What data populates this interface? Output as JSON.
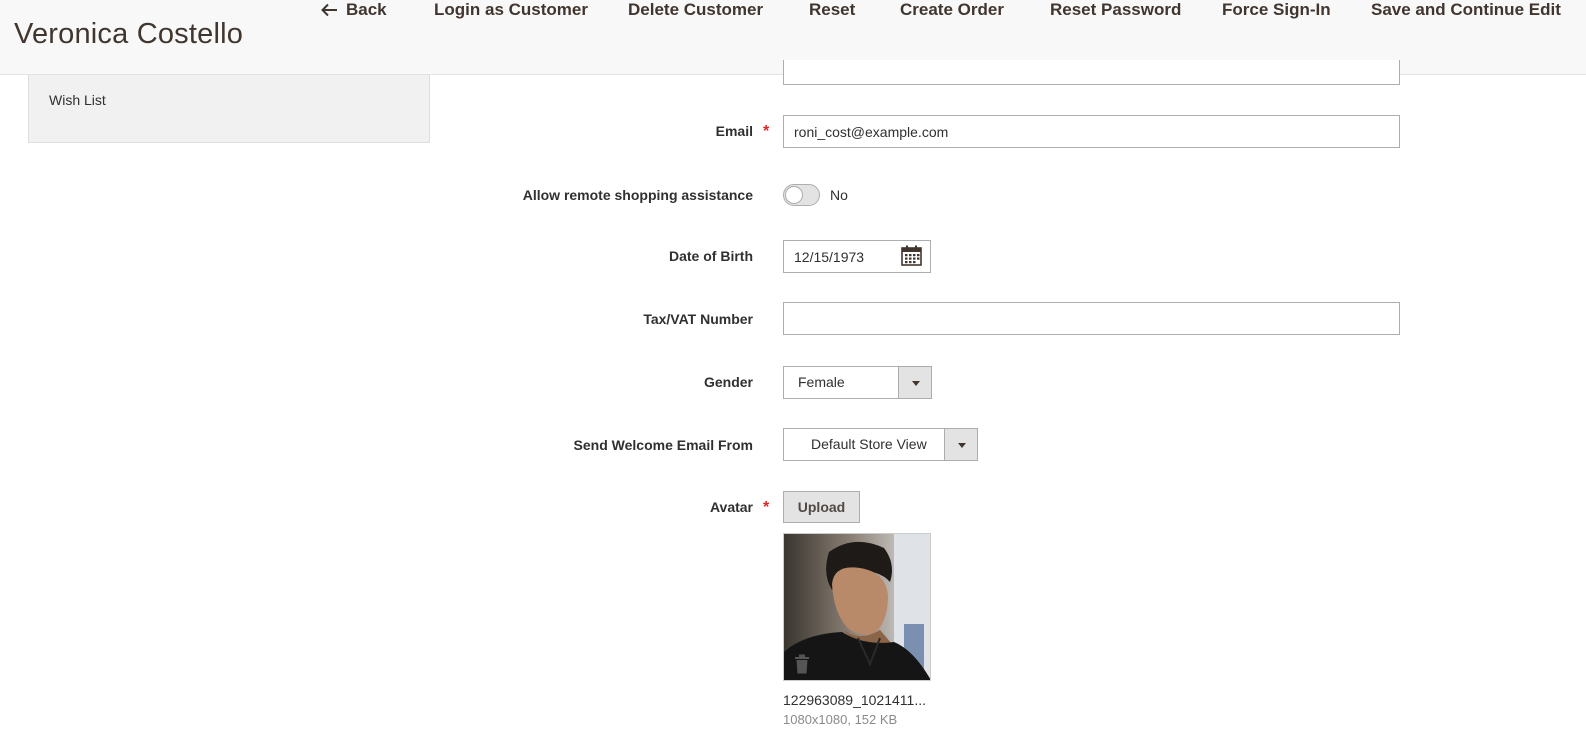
{
  "header": {
    "title": "Veronica Costello",
    "actions": {
      "back": "Back",
      "login_as_customer": "Login as Customer",
      "delete_customer": "Delete Customer",
      "reset": "Reset",
      "create_order": "Create Order",
      "reset_password": "Reset Password",
      "force_sign_in": "Force Sign-In",
      "save_continue": "Save and Continue Edit"
    }
  },
  "sidebar": {
    "items": [
      {
        "label": "Wish List"
      }
    ]
  },
  "form": {
    "email": {
      "label": "Email",
      "value": "roni_cost@example.com",
      "required": true
    },
    "remote_assistance": {
      "label": "Allow remote shopping assistance",
      "state_text": "No",
      "enabled": false
    },
    "dob": {
      "label": "Date of Birth",
      "value": "12/15/1973"
    },
    "tax_vat": {
      "label": "Tax/VAT Number",
      "value": ""
    },
    "gender": {
      "label": "Gender",
      "selected": "Female"
    },
    "welcome_email": {
      "label": "Send Welcome Email From",
      "selected": "Default Store View"
    },
    "avatar": {
      "label": "Avatar",
      "required": true,
      "upload_label": "Upload",
      "file_name": "122963089_1021411...",
      "file_meta": "1080x1080, 152 KB"
    }
  },
  "colors": {
    "required_star": "#e22626",
    "header_bg": "#f8f8f8",
    "title_text": "#41362f"
  },
  "icons": [
    "back-arrow-icon",
    "calendar-icon",
    "chevron-down-icon",
    "trash-icon"
  ]
}
